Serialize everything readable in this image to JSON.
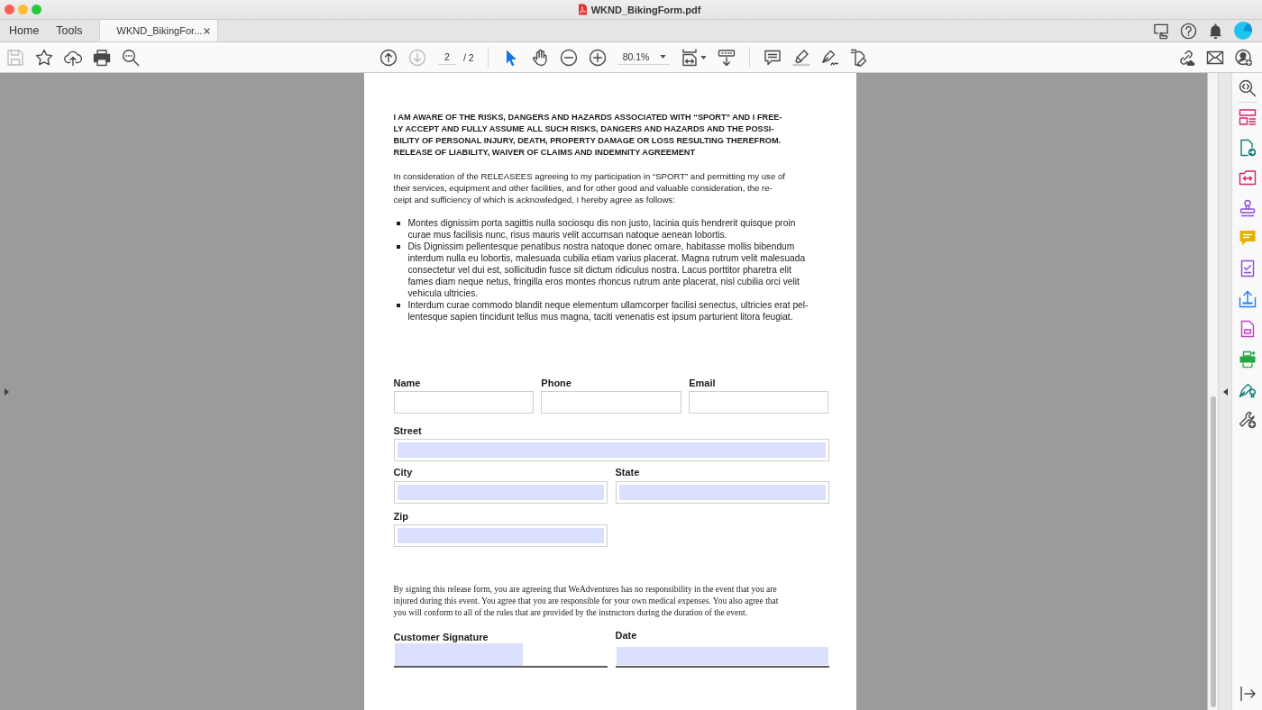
{
  "window": {
    "title": "WKND_BikingForm.pdf"
  },
  "tabs": [
    {
      "label": "Home",
      "kind": "nav",
      "selected": false
    },
    {
      "label": "Tools",
      "kind": "nav",
      "selected": false
    },
    {
      "label": "WKND_BikingFor...",
      "kind": "document",
      "selected": true
    }
  ],
  "toolbar": {
    "file_buttons": [
      {
        "disabled": true
      },
      {
        "disabled": false
      },
      {
        "disabled": false
      },
      {
        "disabled": false
      },
      {
        "disabled": false
      }
    ],
    "page_buttons": [
      {
        "disabled": false
      },
      {
        "disabled": true
      }
    ],
    "page_number": "2",
    "page_count": "/ 2",
    "pointer_tools": [
      {
        "selected": true
      },
      {
        "selected": false
      }
    ],
    "zoom": "80.1%"
  },
  "document": {
    "heading": "I AM AWARE OF THE RISKS, DANGERS AND HAZARDS ASSOCIATED WITH “SPORT” AND I FREE-\nLY ACCEPT AND FULLY ASSUME ALL SUCH RISKS, DANGERS AND HAZARDS AND THE POSSI-\nBILITY OF PERSONAL INJURY, DEATH, PROPERTY DAMAGE OR LOSS RESULTING THEREFROM.\nRELEASE OF LIABILITY, WAIVER OF CLAIMS AND INDEMNITY AGREEMENT",
    "intro": "In consideration of the RELEASEES agreeing to my participation in “SPORT” and permitting my use of\ntheir services, equipment and other facilities, and for other good and valuable consideration, the re-\nceipt and sufficiency of which is acknowledged, I hereby agree as follows:",
    "bullets": [
      "Montes dignissim porta sagittis nulla sociosqu dis non justo, lacinia quis hendrerit quisque proin\ncurae mus facilisis nunc, risus mauris velit accumsan natoque aenean lobortis.",
      "Dis Dignissim pellentesque penatibus nostra natoque donec ornare, habitasse mollis bibendum\ninterdum nulla eu lobortis, malesuada cubilia etiam varius placerat. Magna rutrum velit malesuada\nconsectetur vel dui est, sollicitudin fusce sit dictum ridiculus nostra. Lacus porttitor pharetra elit\nfames diam neque netus, fringilla eros montes rhoncus rutrum ante placerat, nisl cubilia orci velit\nvehicula ultricies.",
      "Interdum curae commodo blandit neque elementum ullamcorper facilisi senectus, ultricies erat pel-\nlentesque sapien tincidunt tellus mus magna, taciti venenatis est ipsum parturient litora feugiat."
    ],
    "contact_fields": [
      {
        "label": "Name",
        "highlighted": false
      },
      {
        "label": "Phone",
        "highlighted": false
      },
      {
        "label": "Email",
        "highlighted": false
      }
    ],
    "street_field": {
      "label": "Street",
      "highlighted": true
    },
    "address_fields": [
      {
        "label": "City",
        "highlighted": true
      },
      {
        "label": "State",
        "highlighted": true
      },
      {
        "label": "Zip",
        "highlighted": true
      }
    ],
    "disclaimer": "By signing this release form, you are agreeing that WeAdventures has no responsibility in the event that you are\ninjured during this event. You agree that you are responsible for your own medical expenses. You also agree that\nyou will conform to all of the rules that are provided by the instructors during the duration of the event.",
    "signature_fields": [
      {
        "label": "Customer Signature",
        "kind": "signature",
        "highlighted": true
      },
      {
        "label": "Date",
        "kind": "date",
        "highlighted": true
      }
    ]
  }
}
